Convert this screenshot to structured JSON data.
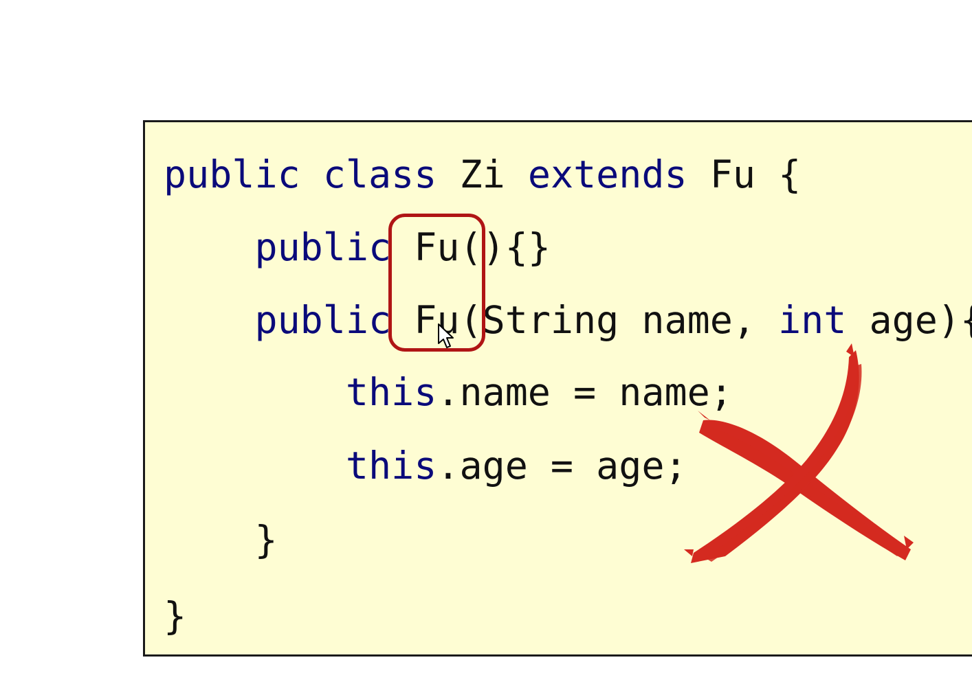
{
  "code": {
    "lines": [
      {
        "indent": "",
        "tokens": [
          {
            "t": "public",
            "kw": true
          },
          {
            "t": " ",
            "kw": false
          },
          {
            "t": "class",
            "kw": true
          },
          {
            "t": " Zi ",
            "kw": false
          },
          {
            "t": "extends",
            "kw": true
          },
          {
            "t": " Fu {",
            "kw": false
          }
        ]
      },
      {
        "indent": "    ",
        "tokens": [
          {
            "t": "public",
            "kw": true
          },
          {
            "t": " Fu(){}",
            "kw": false
          }
        ]
      },
      {
        "indent": "    ",
        "tokens": [
          {
            "t": "public",
            "kw": true
          },
          {
            "t": " Fu(String name, ",
            "kw": false
          },
          {
            "t": "int",
            "kw": true
          },
          {
            "t": " age){",
            "kw": false
          }
        ]
      },
      {
        "indent": "        ",
        "tokens": [
          {
            "t": "this",
            "kw": true
          },
          {
            "t": ".name = name;",
            "kw": false
          }
        ]
      },
      {
        "indent": "        ",
        "tokens": [
          {
            "t": "this",
            "kw": true
          },
          {
            "t": ".age = age;",
            "kw": false
          }
        ]
      },
      {
        "indent": "    ",
        "tokens": [
          {
            "t": "}",
            "kw": false
          }
        ]
      },
      {
        "indent": "",
        "tokens": [
          {
            "t": "}",
            "kw": false
          }
        ]
      }
    ]
  },
  "annotations": {
    "highlight_color": "#b01515",
    "cross_color": "#d42a20",
    "cross_icon": "red-x-mark-icon",
    "cursor_icon": "mouse-pointer-icon"
  },
  "colors": {
    "panel_background": "#fefdd3",
    "keyword": "#0a0a7a",
    "text": "#111111"
  }
}
